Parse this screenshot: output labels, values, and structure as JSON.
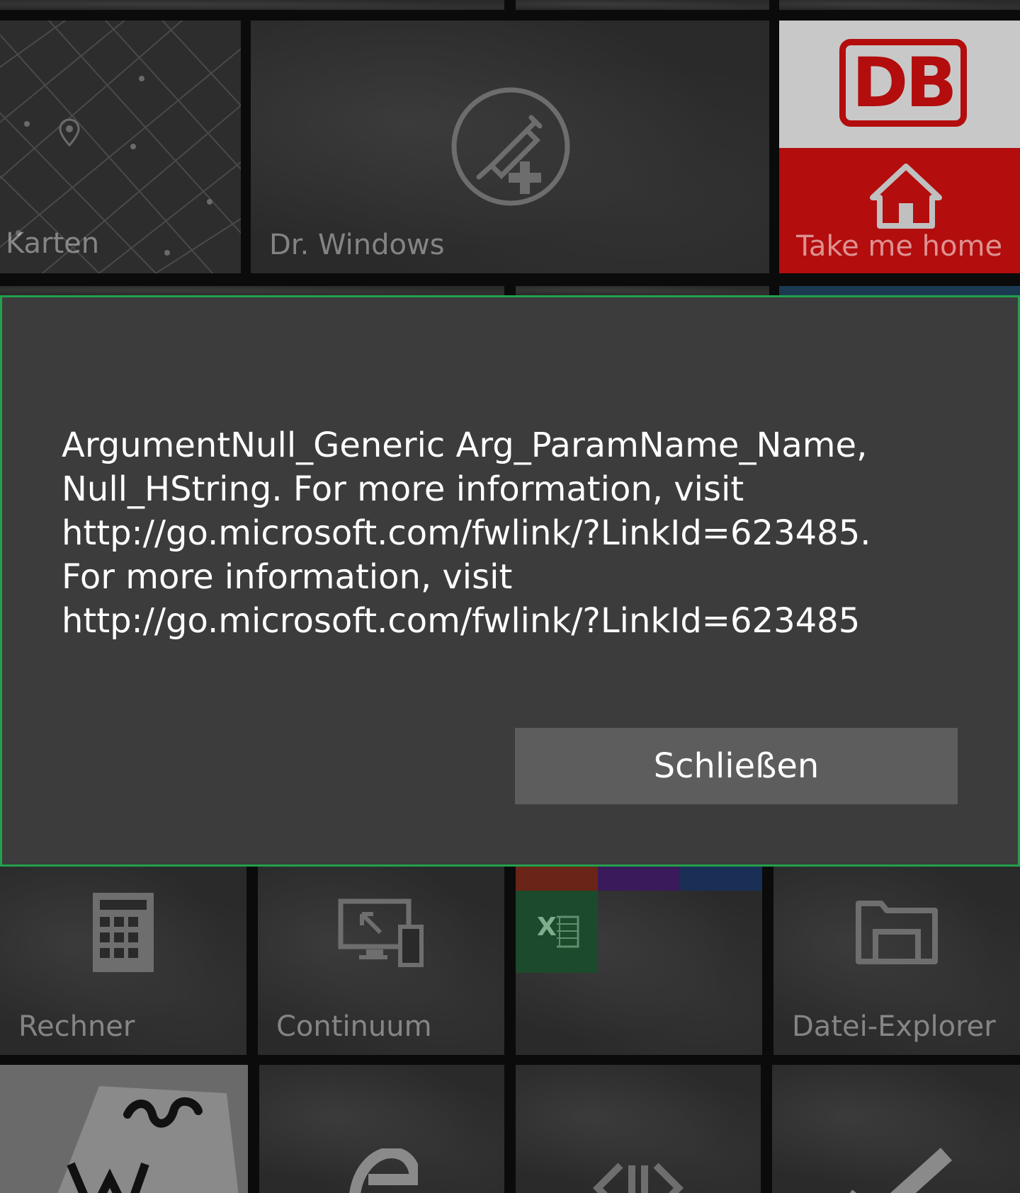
{
  "tiles": {
    "maps": {
      "label": "Karten"
    },
    "drwindows": {
      "label": "Dr. Windows"
    },
    "db": {
      "logo_text": "DB",
      "label": "Take me home"
    },
    "calculator": {
      "label": "Rechner"
    },
    "continuum": {
      "label": "Continuum"
    },
    "excel": {
      "letter": "X"
    },
    "explorer": {
      "label": "Datei-Explorer"
    }
  },
  "dialog": {
    "message": "ArgumentNull_Generic Arg_ParamName_Name, Null_HString. For more information, visit http://go.microsoft.com/fwlink/?LinkId=623485. For more information, visit http://go.microsoft.com/fwlink/?LinkId=623485",
    "button_label": "Schließen"
  },
  "colors": {
    "dialog_border": "#22a04b",
    "dialog_bg": "#3c3c3d",
    "button_bg": "#5d5d5d",
    "db_red": "#b30d0d",
    "excel_green": "#1c4a2c"
  }
}
